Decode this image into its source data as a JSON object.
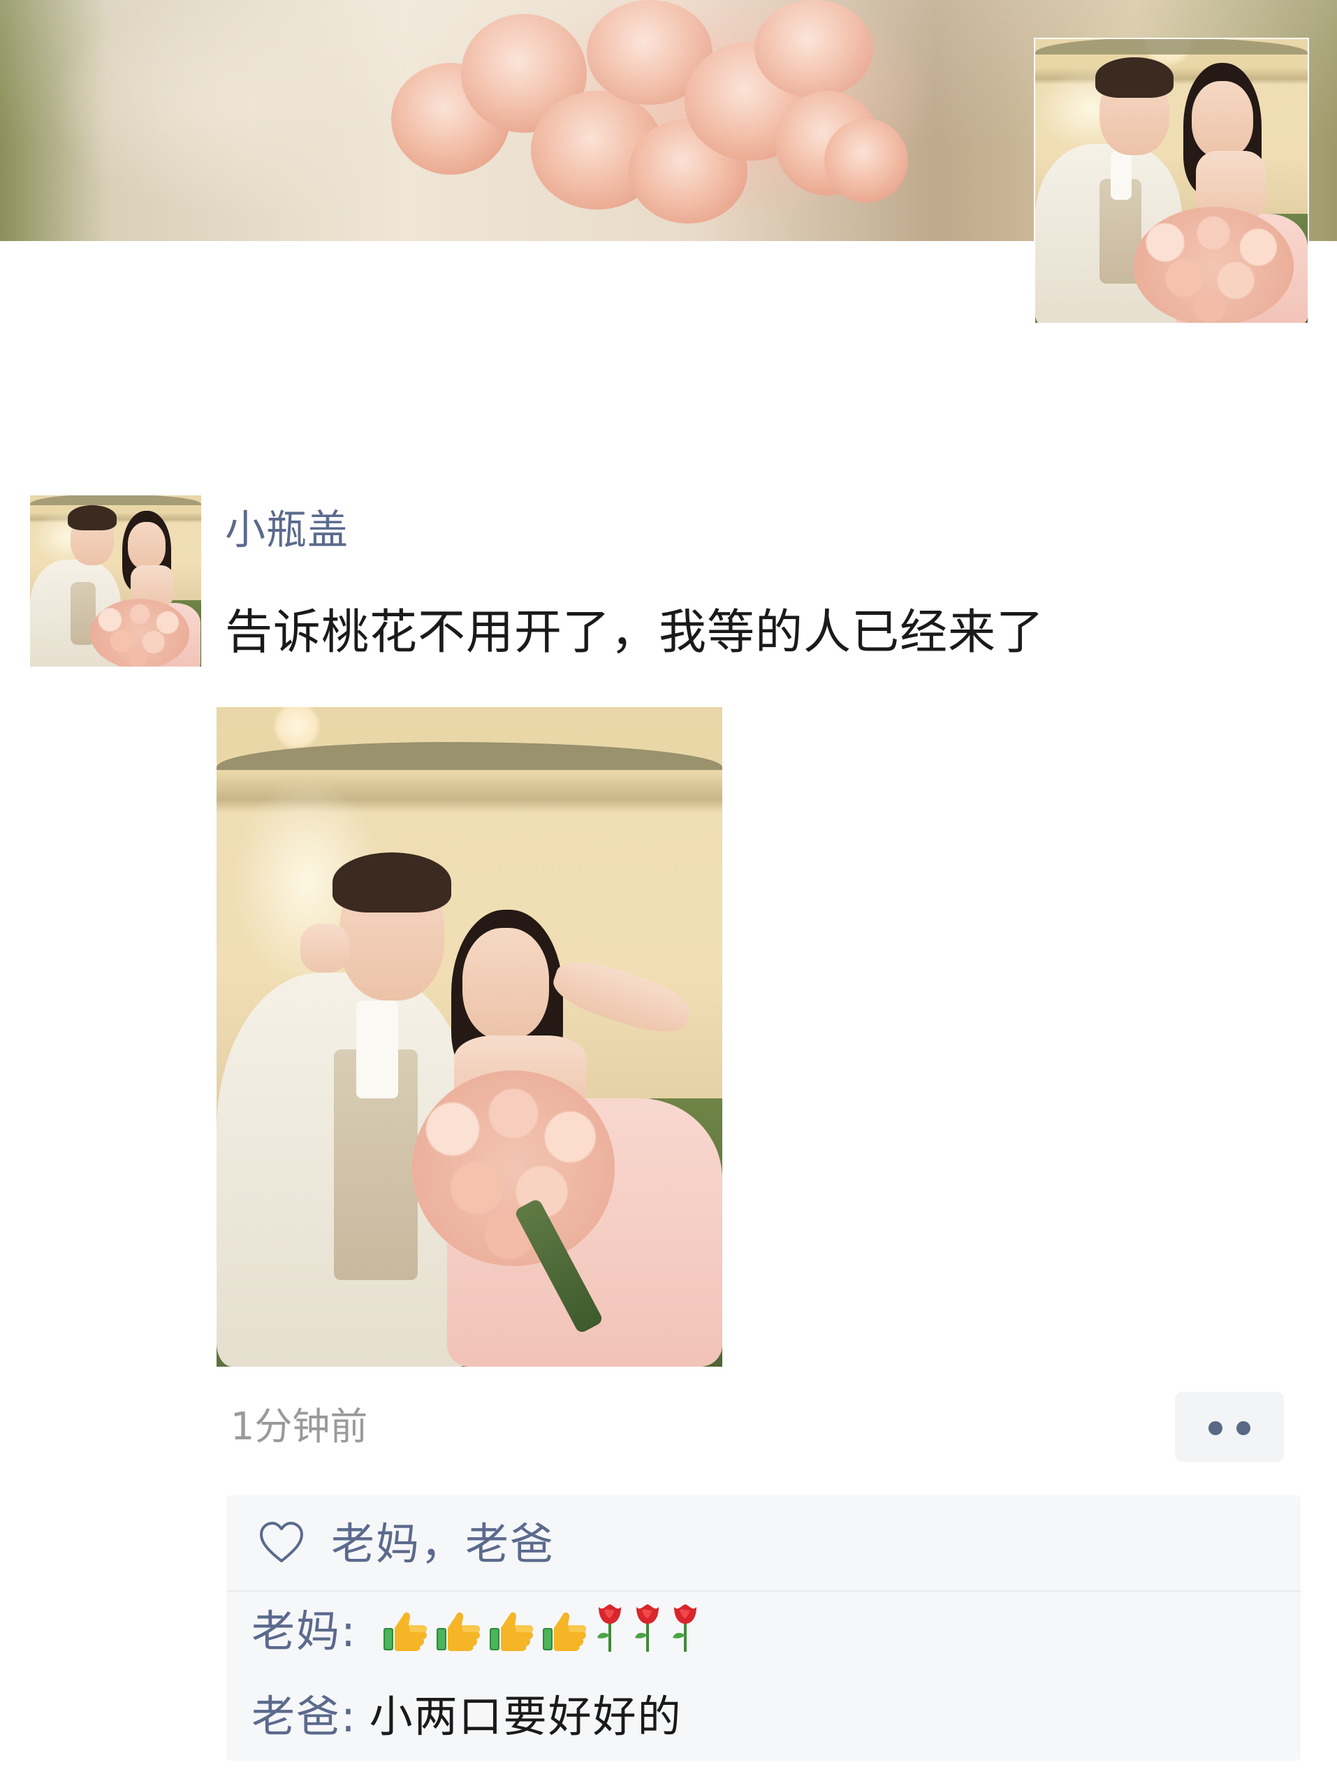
{
  "post": {
    "username": "小瓶盖",
    "text": "告诉桃花不用开了，我等的人已经来了",
    "timestamp": "1分钟前"
  },
  "likes": {
    "names": "老妈，老爸"
  },
  "comments": [
    {
      "author": "老妈",
      "separator": ":",
      "emojis": [
        "thumbs-up-icon",
        "thumbs-up-icon",
        "thumbs-up-icon",
        "thumbs-up-icon",
        "rose-icon",
        "rose-icon",
        "rose-icon"
      ]
    },
    {
      "author": "老爸",
      "separator": ":",
      "text": "小两口要好好的"
    }
  ],
  "colors": {
    "name_link": "#5b6a8d",
    "timestamp": "#9a9a9a",
    "panel_bg": "#f6f7f9"
  }
}
